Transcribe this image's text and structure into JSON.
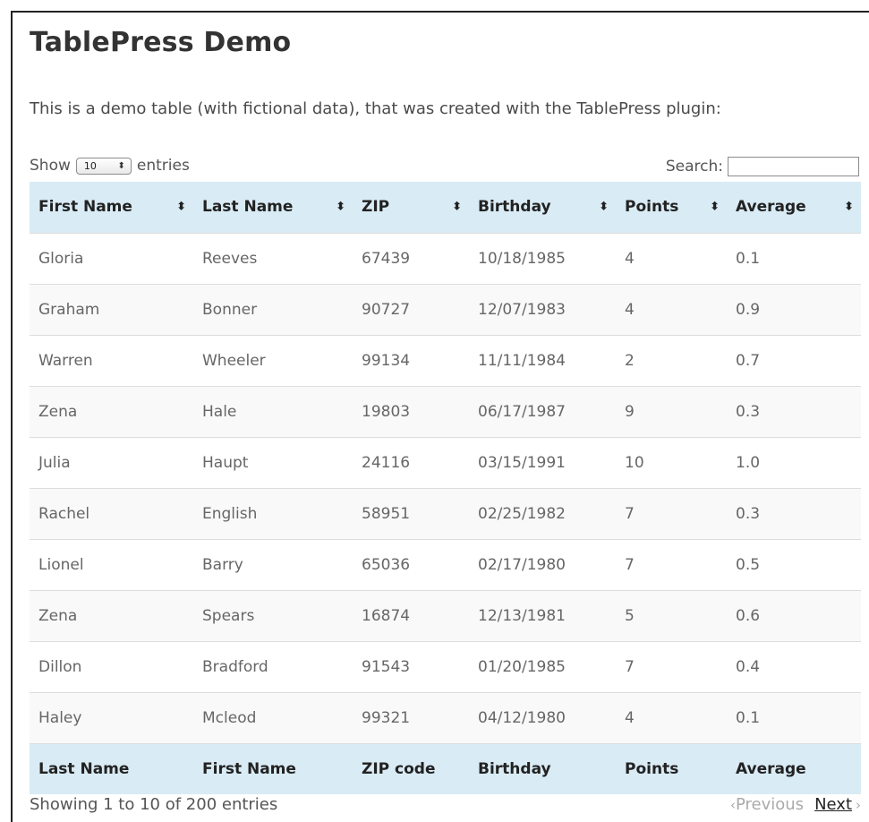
{
  "page": {
    "title": "TablePress Demo",
    "intro": "This is a demo table (with fictional data), that was created with the TablePress plugin:"
  },
  "controls": {
    "show_label": "Show",
    "length_value": "10",
    "entries_label": "entries",
    "search_label": "Search:",
    "search_value": ""
  },
  "table": {
    "headers": [
      "First Name",
      "Last Name",
      "ZIP",
      "Birthday",
      "Points",
      "Average"
    ],
    "rows": [
      [
        "Gloria",
        "Reeves",
        "67439",
        "10/18/1985",
        "4",
        "0.1"
      ],
      [
        "Graham",
        "Bonner",
        "90727",
        "12/07/1983",
        "4",
        "0.9"
      ],
      [
        "Warren",
        "Wheeler",
        "99134",
        "11/11/1984",
        "2",
        "0.7"
      ],
      [
        "Zena",
        "Hale",
        "19803",
        "06/17/1987",
        "9",
        "0.3"
      ],
      [
        "Julia",
        "Haupt",
        "24116",
        "03/15/1991",
        "10",
        "1.0"
      ],
      [
        "Rachel",
        "English",
        "58951",
        "02/25/1982",
        "7",
        "0.3"
      ],
      [
        "Lionel",
        "Barry",
        "65036",
        "02/17/1980",
        "7",
        "0.5"
      ],
      [
        "Zena",
        "Spears",
        "16874",
        "12/13/1981",
        "5",
        "0.6"
      ],
      [
        "Dillon",
        "Bradford",
        "91543",
        "01/20/1985",
        "7",
        "0.4"
      ],
      [
        "Haley",
        "Mcleod",
        "99321",
        "04/12/1980",
        "4",
        "0.1"
      ]
    ],
    "footer": [
      "Last Name",
      "First Name",
      "ZIP code",
      "Birthday",
      "Points",
      "Average"
    ]
  },
  "pagination": {
    "info": "Showing 1 to 10 of 200 entries",
    "previous": "Previous",
    "next": "Next"
  },
  "colors": {
    "header_bg": "#d9ebf5",
    "stripe_bg": "#f9f9f9",
    "border": "#dddddd"
  },
  "icons": {
    "sort": "sort-both-icon",
    "prev": "chevron-left-icon",
    "next": "chevron-right-icon",
    "select": "select-arrows-icon"
  }
}
